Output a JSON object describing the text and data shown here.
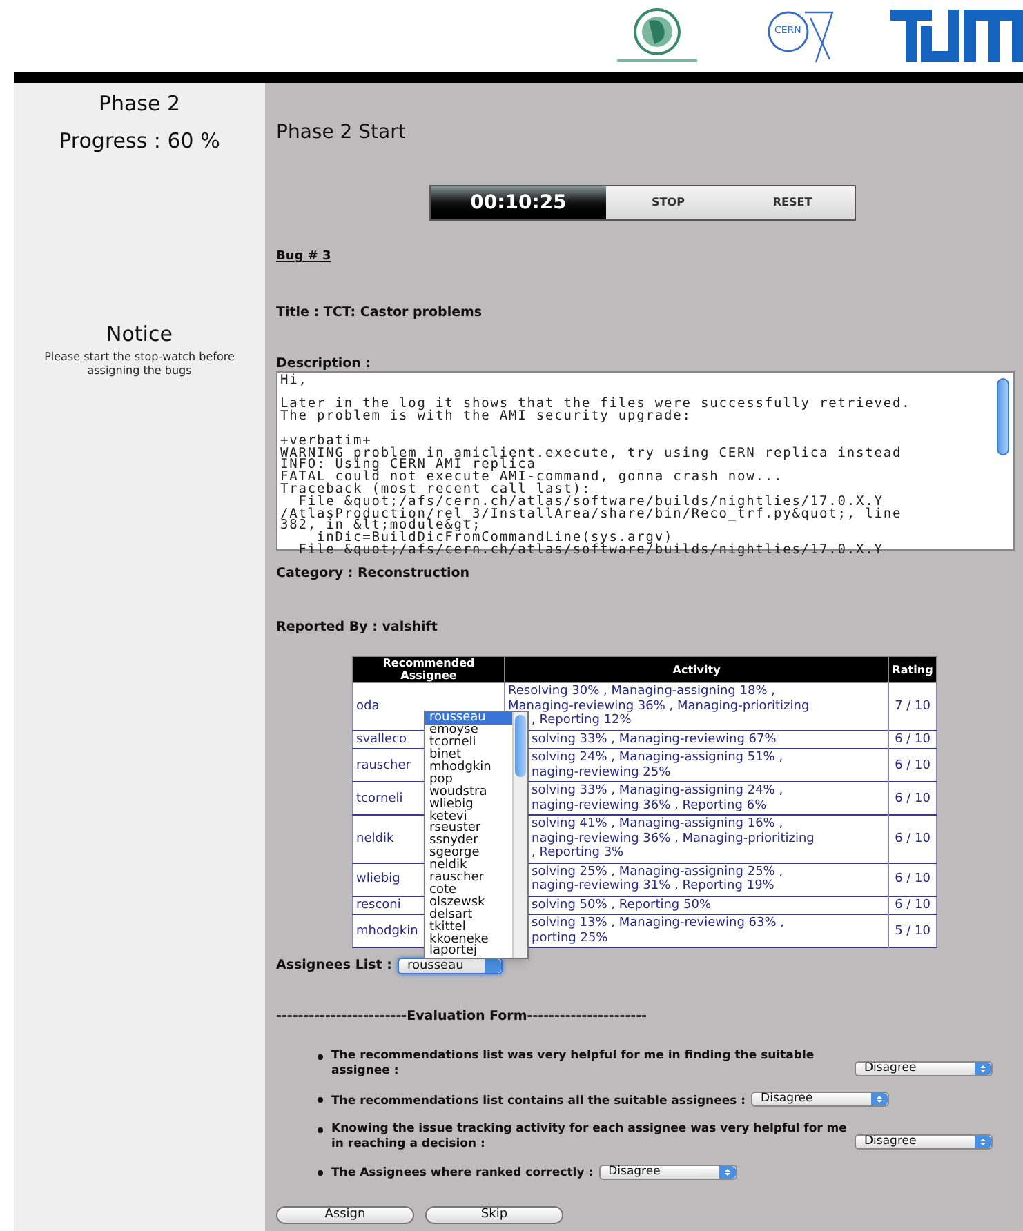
{
  "logos": {
    "cern_label": "CERN"
  },
  "sidebar": {
    "phase": "Phase 2",
    "progress": "Progress : 60 %",
    "notice_title": "Notice",
    "notice_text": "Please start the stop-watch before assigning the bugs"
  },
  "heading": "Phase 2 Start",
  "stopwatch": {
    "time": "00:10:25",
    "buttons": [
      "STOP",
      "RESET"
    ]
  },
  "bug": {
    "number": "Bug # 3",
    "title": "Title : TCT: Castor problems",
    "description_label": "Description :",
    "description": "Hi,\n\nLater in the log it shows that the files were successfully retrieved.\nThe problem is with the AMI security upgrade:\n\n+verbatim+\nWARNING problem in amiclient.execute, try using CERN replica instead\nINFO: Using CERN AMI replica\nFATAL could not execute AMI-command, gonna crash now...\nTraceback (most recent call last):\n  File &quot;/afs/cern.ch/atlas/software/builds/nightlies/17.0.X.Y\n/AtlasProduction/rel_3/InstallArea/share/bin/Reco_trf.py&quot;, line\n382, in &lt;module&gt;\n    inDic=BuildDicFromCommandLine(sys.argv)\n  File &quot;/afs/cern.ch/atlas/software/builds/nightlies/17.0.X.Y",
    "category": "Category : Reconstruction",
    "reported_by": "Reported By : valshift"
  },
  "table": {
    "columns": [
      "Recommended Assignee",
      "Activity",
      "Rating"
    ],
    "rows": [
      {
        "assignee": "oda",
        "rating": "7 / 10",
        "activity_lines": [
          "Resolving 30% , Managing-assigning 18% ,",
          "Managing-reviewing 36% , Managing-prioritizing"
        ],
        "activity_cut_lines": [
          ", Reporting 12%"
        ]
      },
      {
        "assignee": "svalleco",
        "rating": "6 / 10",
        "activity_cut_lines": [
          "solving 33% , Managing-reviewing 67%"
        ]
      },
      {
        "assignee": "rauscher",
        "rating": "6 / 10",
        "activity_cut_lines": [
          "solving 24% , Managing-assigning 51% ,",
          "naging-reviewing 25%"
        ]
      },
      {
        "assignee": "tcorneli",
        "rating": "6 / 10",
        "activity_cut_lines": [
          "solving 33% , Managing-assigning 24% ,",
          "naging-reviewing 36% , Reporting 6%"
        ]
      },
      {
        "assignee": "neldik",
        "rating": "6 / 10",
        "activity_cut_lines": [
          "solving 41% , Managing-assigning 16% ,",
          "naging-reviewing 36% , Managing-prioritizing",
          ", Reporting 3%"
        ]
      },
      {
        "assignee": "wliebig",
        "rating": "6 / 10",
        "activity_cut_lines": [
          "solving 25% , Managing-assigning 25% ,",
          "naging-reviewing 31% , Reporting 19%"
        ]
      },
      {
        "assignee": "resconi",
        "rating": "6 / 10",
        "activity_cut_lines": [
          "solving 50% , Reporting 50%"
        ]
      },
      {
        "assignee": "mhodgkin",
        "rating": "5 / 10",
        "activity_cut_lines": [
          "solving 13% , Managing-reviewing 63% ,",
          "porting 25%"
        ]
      }
    ]
  },
  "assignees": {
    "label": "Assignees List :",
    "value": "rousseau",
    "expanded": true,
    "options": [
      {
        "name": "rousseau",
        "selected": true
      },
      {
        "name": "emoyse",
        "selected": false
      },
      {
        "name": "tcorneli",
        "selected": false
      },
      {
        "name": "binet",
        "selected": false
      },
      {
        "name": "mhodgkin",
        "selected": false
      },
      {
        "name": "pop",
        "selected": false
      },
      {
        "name": "woudstra",
        "selected": false
      },
      {
        "name": "wliebig",
        "selected": false
      },
      {
        "name": "ketevi",
        "selected": false
      },
      {
        "name": "rseuster",
        "selected": false
      },
      {
        "name": "ssnyder",
        "selected": false
      },
      {
        "name": "sgeorge",
        "selected": false
      },
      {
        "name": "neldik",
        "selected": false
      },
      {
        "name": "rauscher",
        "selected": false
      },
      {
        "name": "cote",
        "selected": false
      },
      {
        "name": "olszewsk",
        "selected": false
      },
      {
        "name": "delsart",
        "selected": false
      },
      {
        "name": "tkittel",
        "selected": false
      },
      {
        "name": "kkoeneke",
        "selected": false
      },
      {
        "name": "laportej",
        "selected": false
      }
    ]
  },
  "evaluation": {
    "heading": "------------------------Evaluation Form----------------------",
    "questions": [
      {
        "text": "The recommendations list was very helpful for me in finding the suitable assignee :",
        "answer": "Disagree"
      },
      {
        "text": "The recommendations list contains all the suitable assignees :",
        "answer": "Disagree"
      },
      {
        "text": "Knowing the issue tracking activity for each assignee was very helpful for me in reaching a decision :",
        "answer": "Disagree"
      },
      {
        "text": "The Assignees where ranked correctly :",
        "answer": "Disagree"
      }
    ]
  },
  "buttons": [
    "Assign",
    "Skip"
  ]
}
